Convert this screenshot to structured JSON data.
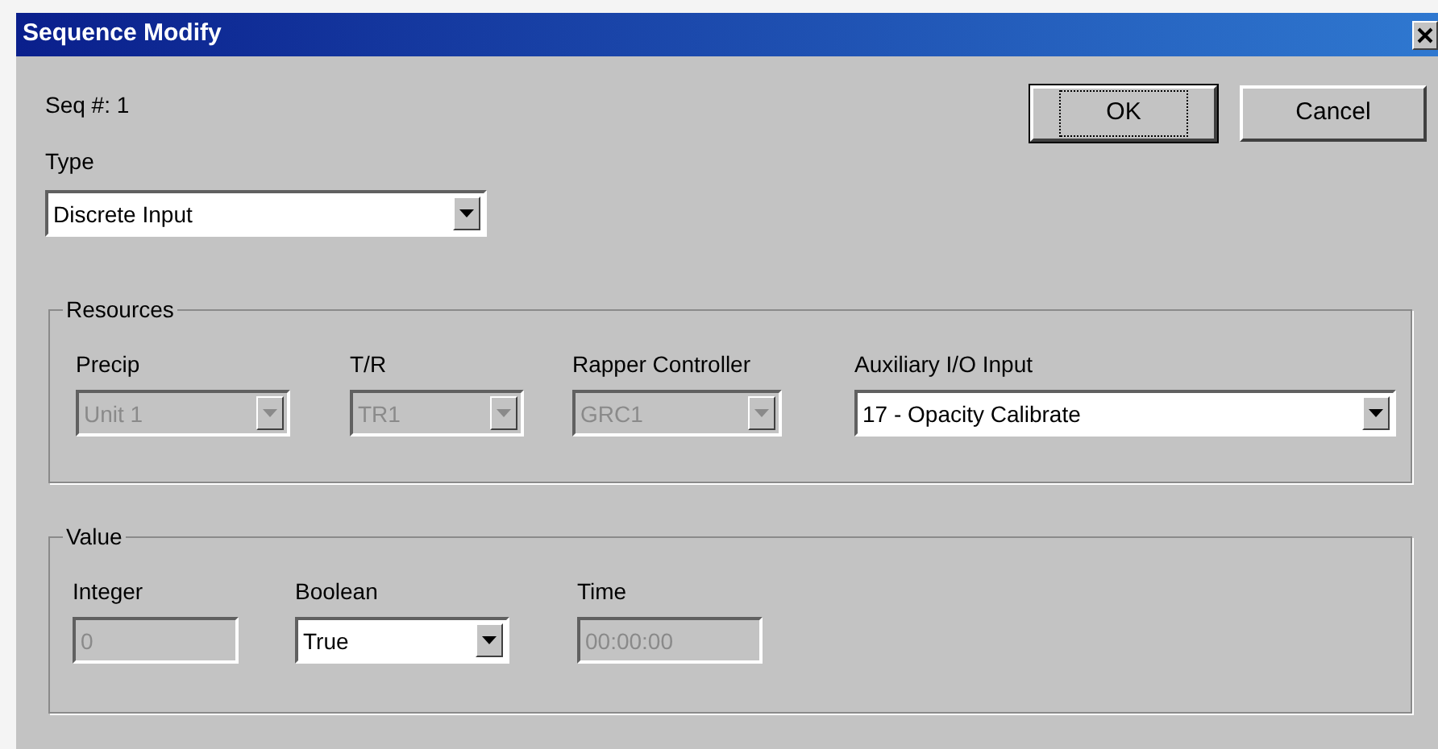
{
  "window": {
    "title": "Sequence Modify"
  },
  "seq": {
    "label": "Seq #:",
    "value": "1"
  },
  "type": {
    "label": "Type",
    "kind": "combo",
    "value": "Discrete Input",
    "disabled": false
  },
  "buttons": [
    {
      "label": "OK",
      "focused": true
    },
    {
      "label": "Cancel",
      "focused": false
    }
  ],
  "groups": [
    {
      "title": "Resources",
      "fields": [
        {
          "label": "Precip",
          "kind": "combo",
          "value": "Unit 1",
          "disabled": true
        },
        {
          "label": "T/R",
          "kind": "combo",
          "value": "TR1",
          "disabled": true
        },
        {
          "label": "Rapper Controller",
          "kind": "combo",
          "value": "GRC1",
          "disabled": true
        },
        {
          "label": "Auxiliary I/O Input",
          "kind": "combo",
          "value": "17 - Opacity Calibrate",
          "disabled": false
        }
      ]
    },
    {
      "title": "Value",
      "fields": [
        {
          "label": "Integer",
          "kind": "text",
          "value": "0",
          "disabled": true
        },
        {
          "label": "Boolean",
          "kind": "combo",
          "value": "True",
          "disabled": false
        },
        {
          "label": "Time",
          "kind": "text",
          "value": "00:00:00",
          "disabled": true
        }
      ]
    }
  ]
}
